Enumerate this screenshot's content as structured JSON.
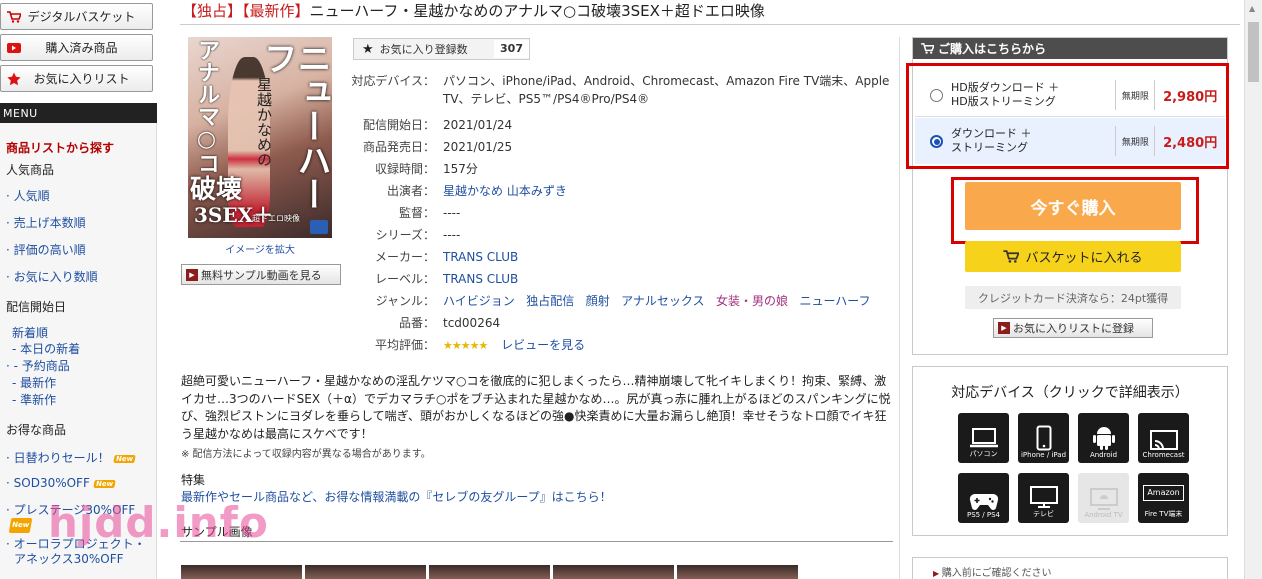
{
  "sidebar": {
    "basket_label": "デジタルバスケット",
    "purchased_label": "購入済み商品",
    "favorites_label": "お気に入りリスト",
    "menu_header": "MENU",
    "list_search": "商品リストから探す",
    "popular_header": "人気商品",
    "popular_items": [
      "人気順",
      "売上げ本数順",
      "評価の高い順",
      "お気に入り数順"
    ],
    "release_header": "配信開始日",
    "new_label": "新着順",
    "release_items": [
      "本日の新着",
      "予約商品",
      "最新作",
      "準新作"
    ],
    "deals_header": "お得な商品",
    "deal_items": [
      "日替わりセール！",
      "SOD30%OFF",
      "プレステージ30%OFF",
      "オーロラプロジェクト・"
    ],
    "new_badge": "New",
    "cutoff_text": "アネックス30%OFF"
  },
  "product": {
    "title_tag": "【独占】【最新作】",
    "title": "ニューハーフ・星越かなめのアナルマ○コ破壊3SEX＋超ドエロ映像",
    "enlarge_label": "イメージを拡大",
    "sample_video_label": "無料サンプル動画を見る",
    "cover": {
      "tall_text": "ニューハーフ",
      "left_text": "アナルマ○コ",
      "mid_text": "星越かなめの",
      "hakai": "破壊",
      "sex": "3SEX＋",
      "extra": "超ドエロ映像"
    }
  },
  "favorites": {
    "label": "お気に入り登録数",
    "count": "307"
  },
  "info": {
    "devices_key": "対応デバイス：",
    "devices_val": "パソコン、iPhone/iPad、Android、Chromecast、Amazon Fire TV端末、Apple TV、テレビ、PS5™/PS4®Pro/PS4®",
    "start_key": "配信開始日：",
    "start_val": "2021/01/24",
    "release_key": "商品発売日：",
    "release_val": "2021/01/25",
    "duration_key": "収録時間：",
    "duration_val": "157分",
    "cast_key": "出演者：",
    "cast_val": "星越かなめ 山本みずき",
    "director_key": "監督：",
    "director_val": "----",
    "series_key": "シリーズ：",
    "series_val": "----",
    "maker_key": "メーカー：",
    "maker_val": "TRANS CLUB",
    "label_key": "レーベル：",
    "label_val": "TRANS CLUB",
    "genre_key": "ジャンル：",
    "genres": [
      "ハイビジョン",
      "独占配信",
      "顔射",
      "アナルセックス",
      "女装・男の娘",
      "ニューハーフ"
    ],
    "code_key": "品番：",
    "code_val": "tcd00264",
    "rating_key": "平均評価：",
    "rating_stars": "★★★★★",
    "review_link": "レビューを見る"
  },
  "description": "超絶可愛いニューハーフ・星越かなめの淫乱ケツマ○コを徹底的に犯しまくったら…精神崩壊して牝イキしまくり！拘束、緊縛、激イカせ…3つのハードSEX（＋α）でデカマラチ○ポをブチ込まれた星越かなめ…。尻が真っ赤に腫れ上がるほどのスパンキングに悦び、強烈ピストンにヨダレを垂らして喘ぎ、頭がおかしくなるほどの強●快楽責めに大量お漏らし絶頂！幸せそうなトロ顔でイキ狂う星越かなめは最高にスケベです！",
  "note": "※ 配信方法によって収録内容が異なる場合があります。",
  "tokushu": {
    "header": "特集",
    "link": "最新作やセール商品など、お得な情報満載の『セレブの友グループ』はこちら！"
  },
  "sample_images_header": "サンプル画像",
  "watermark": "hjdd.info",
  "purchase": {
    "header": "ご購入はこちらから",
    "options": [
      {
        "name_line1": "HD版ダウンロード ＋",
        "name_line2": "HD版ストリーミング",
        "limit": "無期限",
        "price": "2,980円"
      },
      {
        "name_line1": "ダウンロード ＋",
        "name_line2": "ストリーミング",
        "limit": "無期限",
        "price": "2,480円"
      }
    ],
    "buy_now": "今すぐ購入",
    "basket": "バスケットに入れる",
    "credit": "クレジットカード決済なら：24pt獲得",
    "fav_register": "お気に入りリストに登録"
  },
  "devices": {
    "title": "対応デバイス（クリックで詳細表示）",
    "items": [
      {
        "label": "パソコン",
        "icon": "laptop-icon",
        "glyph": "💻"
      },
      {
        "label": "iPhone / iPad",
        "icon": "phone-icon",
        "glyph": "📱"
      },
      {
        "label": "Android",
        "icon": "android-icon",
        "glyph": "🤖"
      },
      {
        "label": "Chromecast",
        "icon": "cast-icon",
        "glyph": "📺"
      },
      {
        "label": "PS5 / PS4",
        "icon": "gamepad-icon",
        "glyph": "🎮"
      },
      {
        "label": "テレビ",
        "icon": "tv-icon",
        "glyph": "🖥"
      },
      {
        "label": "Android TV",
        "icon": "android-tv-icon",
        "glyph": "🖥"
      },
      {
        "label": "Amazon\nFire TV端末",
        "icon": "firetv-icon",
        "glyph": "Amazon"
      }
    ]
  },
  "next_panel_text": "購入前にご確認ください",
  "colors": {
    "accent_red": "#c81c1c",
    "buy_orange": "#f9a94b",
    "basket_yellow": "#f7d21a",
    "link_blue": "#1f4fa0"
  }
}
